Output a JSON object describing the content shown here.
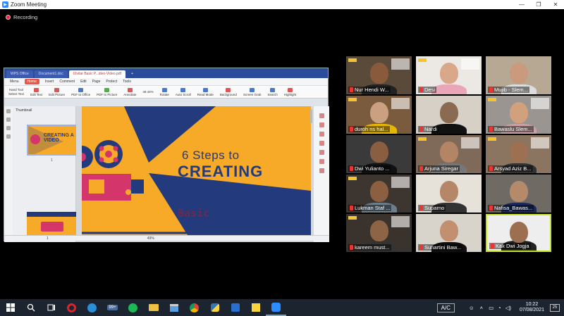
{
  "window": {
    "title": "Zoom Meeting",
    "controls": [
      "—",
      "❐",
      "✕"
    ]
  },
  "recording": {
    "label": "Recording"
  },
  "shared_app": {
    "tabs": [
      "WPS Office",
      "Document1.doc",
      "Ulvitar Basic P...ideo-Video.pdf",
      "+"
    ],
    "menu": [
      "Menu",
      "Home",
      "Insert",
      "Comment",
      "Edit",
      "Page",
      "Protect",
      "Tools"
    ],
    "toolbar": [
      "Hand Tool",
      "Select Text",
      "Edit Text",
      "Edit Picture",
      "PDF to Office",
      "PDF to Picture",
      "Annotate",
      "Rotate",
      "Auto Scroll",
      "Read Mode",
      "Background",
      "Screen Grab",
      "Search",
      "Highlight"
    ],
    "zoom": "49.44%",
    "thumbnail_label": "Thumbnail",
    "thumb_page": "1",
    "slide": {
      "line1": "6 Steps to",
      "line2": "CREATING",
      "line3": "A VIDEO",
      "line4": "Basic"
    },
    "thumb_text": "CREATING A VIDEO",
    "status_page": "1",
    "status_zoom": "49%"
  },
  "participants": [
    {
      "name": "Nur Hendi W...",
      "skin": "#8a5a3c",
      "shirt": "#222",
      "bg": "#5a4a3a",
      "poster": true
    },
    {
      "name": "Desi",
      "skin": "#d9a88a",
      "shirt": "#e9a6b8",
      "bg": "#ece8e4",
      "poster": true
    },
    {
      "name": "Mujib - Slem...",
      "skin": "#c99a7c",
      "shirt": "#ddd",
      "bg": "#b7a894",
      "poster": false
    },
    {
      "name": "duroh ns hal...",
      "skin": "#caa080",
      "shirt": "#e6b600",
      "bg": "#7a5b3e",
      "poster": true
    },
    {
      "name": "Nardi",
      "skin": "#8a6a50",
      "shirt": "#111",
      "bg": "#d7d0c6",
      "poster": false
    },
    {
      "name": "Bawaslu Slem...",
      "skin": "#d1a17e",
      "shirt": "#c8a2a4",
      "bg": "#9a9590",
      "poster": true
    },
    {
      "name": "Dwi Yulianto ...",
      "skin": "#8a5e40",
      "shirt": "#111",
      "bg": "#3a3a3a",
      "poster": false
    },
    {
      "name": "Arjuna Siregar",
      "skin": "#b48565",
      "shirt": "#777",
      "bg": "#7f6a59",
      "poster": true
    },
    {
      "name": "Arsyad Aziz B...",
      "skin": "#9c7050",
      "shirt": "#333",
      "bg": "#8b7460",
      "poster": true
    },
    {
      "name": "Lukman Staf ...",
      "skin": "#8c5f40",
      "shirt": "#6b7e8c",
      "bg": "#3d3630",
      "poster": true
    },
    {
      "name": "Suparno",
      "skin": "#b58768",
      "shirt": "#333",
      "bg": "#e6e2da",
      "poster": false
    },
    {
      "name": "Nafisa_Bawas...",
      "skin": "#b58a6a",
      "shirt": "#1a2a5a",
      "bg": "#6f6a64",
      "poster": false
    },
    {
      "name": "kareem must...",
      "skin": "#8e6446",
      "shirt": "#333",
      "bg": "#3a322c",
      "poster": true
    },
    {
      "name": "Sunartini Baw...",
      "skin": "#c29070",
      "shirt": "#0f0f0f",
      "bg": "#d8d4cc",
      "poster": false
    },
    {
      "name": "Kak Dwi Jogja",
      "skin": "#9b6f4f",
      "shirt": "#222",
      "bg": "#eeeeee",
      "poster": false
    }
  ],
  "taskbar": {
    "icons": [
      "windows-icon",
      "search-icon",
      "task-view-icon",
      "opera-icon",
      "edge-icon",
      "badge-99-icon",
      "spotify-icon",
      "file-explorer-icon",
      "store-icon",
      "chrome-icon",
      "python-icon",
      "paint-icon",
      "sticky-notes-icon",
      "zoom-icon"
    ],
    "badge": "99+",
    "ac_label": "A/C",
    "time": "10:22",
    "date": "07/08/2021",
    "notif_count": "25"
  },
  "colors": {
    "slide_bg": "#f7a928",
    "slide_navy": "#233a7c",
    "slide_pink": "#d4356a",
    "active_border": "#c8e02a"
  }
}
